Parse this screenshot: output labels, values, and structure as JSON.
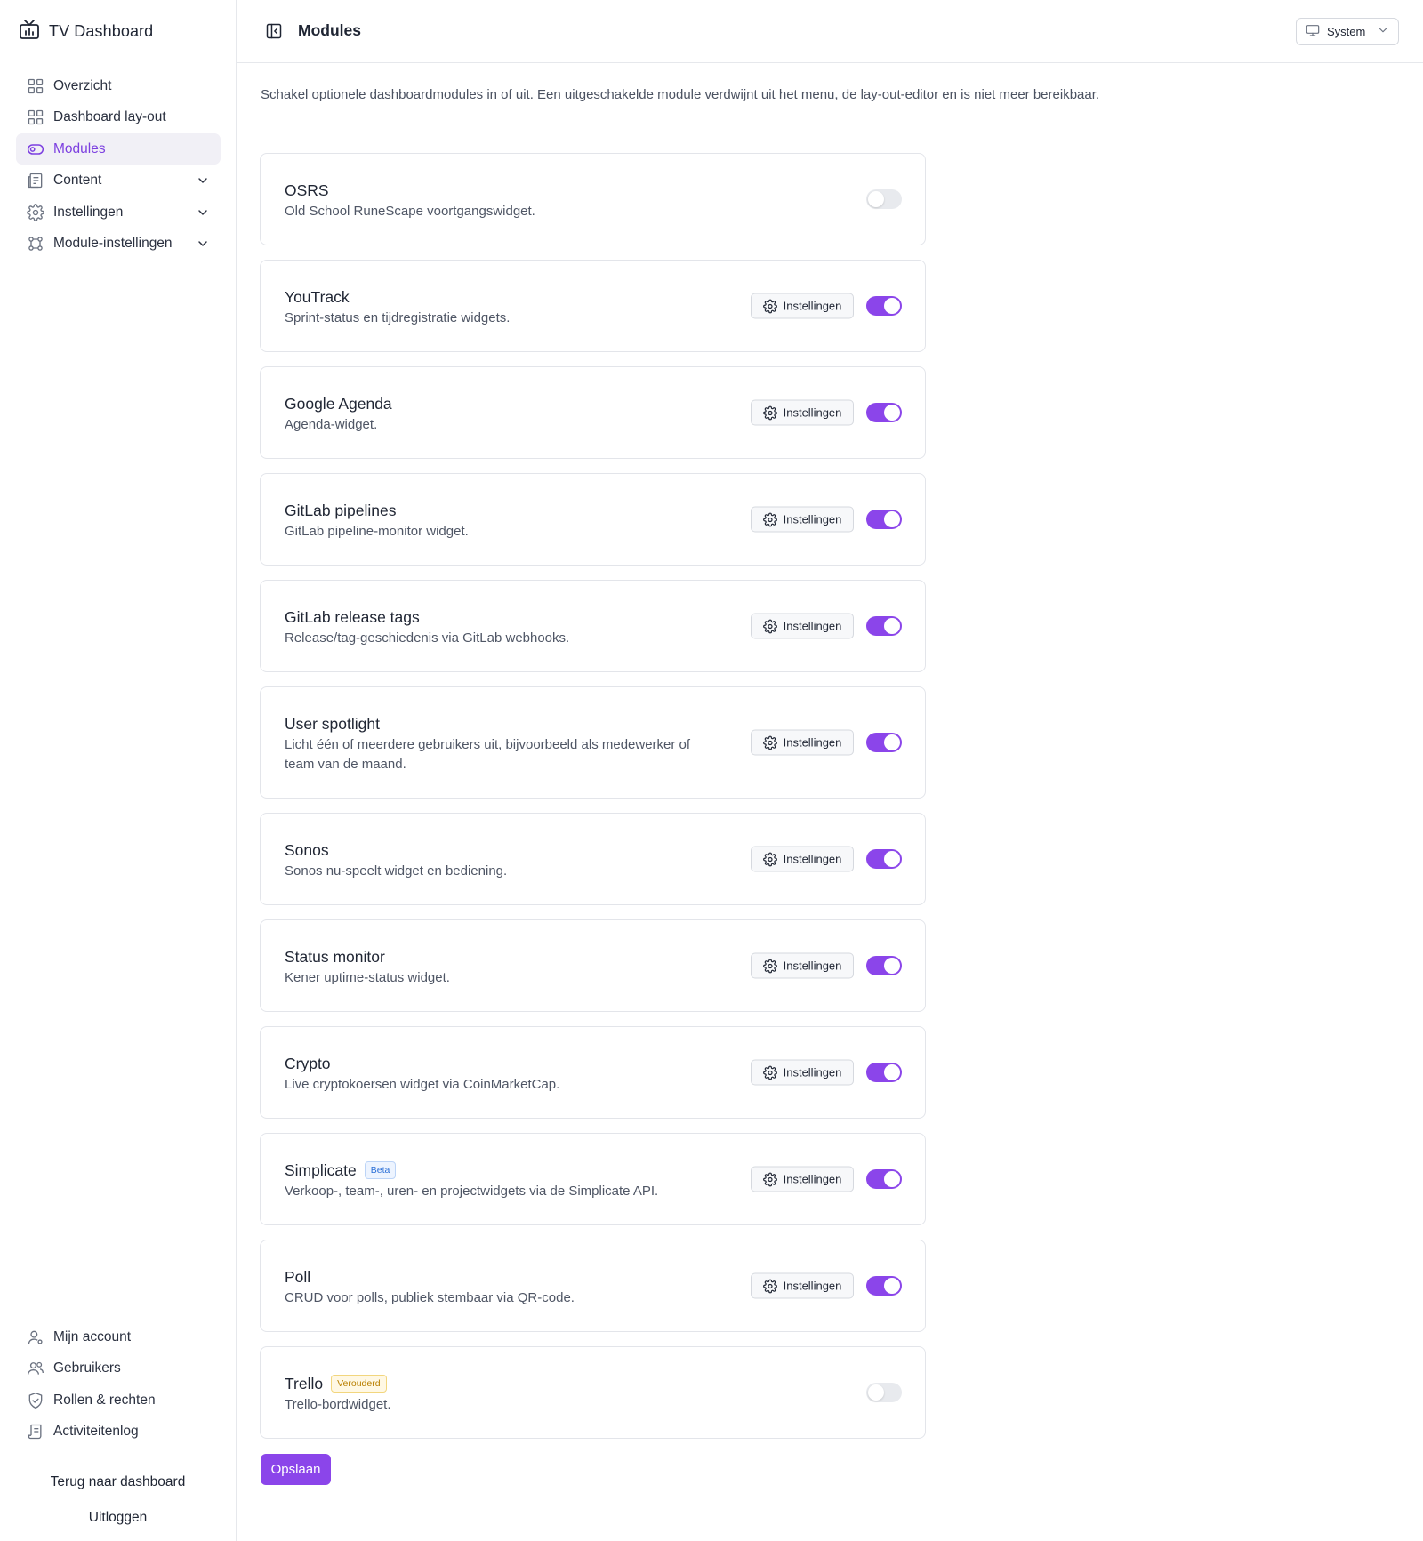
{
  "app": {
    "title": "TV Dashboard"
  },
  "sidebar": {
    "nav": [
      {
        "label": "Overzicht",
        "icon": "grid-icon",
        "active": false,
        "expandable": false
      },
      {
        "label": "Dashboard lay-out",
        "icon": "layout-icon",
        "active": false,
        "expandable": false
      },
      {
        "label": "Modules",
        "icon": "toggle-icon",
        "active": true,
        "expandable": false
      },
      {
        "label": "Content",
        "icon": "content-icon",
        "active": false,
        "expandable": true
      },
      {
        "label": "Instellingen",
        "icon": "gear-icon",
        "active": false,
        "expandable": true
      },
      {
        "label": "Module-instellingen",
        "icon": "puzzle-icon",
        "active": false,
        "expandable": true
      }
    ],
    "bottom_nav": [
      {
        "label": "Mijn account",
        "icon": "user-icon"
      },
      {
        "label": "Gebruikers",
        "icon": "users-icon"
      },
      {
        "label": "Rollen & rechten",
        "icon": "shield-icon"
      },
      {
        "label": "Activiteitenlog",
        "icon": "log-icon"
      }
    ],
    "footer": {
      "back_label": "Terug naar dashboard",
      "logout_label": "Uitloggen"
    }
  },
  "header": {
    "title": "Modules",
    "theme_select": {
      "value": "System"
    }
  },
  "main": {
    "intro": "Schakel optionele dashboardmodules in of uit. Een uitgeschakelde module verdwijnt uit het menu, de lay-out-editor en is niet meer bereikbaar.",
    "settings_label": "Instellingen",
    "save_label": "Opslaan",
    "modules": [
      {
        "title": "OSRS",
        "description": "Old School RuneScape voortgangswidget.",
        "enabled": false,
        "has_settings": false
      },
      {
        "title": "YouTrack",
        "description": "Sprint-status en tijdregistratie widgets.",
        "enabled": true,
        "has_settings": true
      },
      {
        "title": "Google Agenda",
        "description": "Agenda-widget.",
        "enabled": true,
        "has_settings": true
      },
      {
        "title": "GitLab pipelines",
        "description": "GitLab pipeline-monitor widget.",
        "enabled": true,
        "has_settings": true
      },
      {
        "title": "GitLab release tags",
        "description": "Release/tag-geschiedenis via GitLab webhooks.",
        "enabled": true,
        "has_settings": true
      },
      {
        "title": "User spotlight",
        "description": "Licht één of meerdere gebruikers uit, bijvoorbeeld als medewerker of team van de maand.",
        "enabled": true,
        "has_settings": true,
        "tall": true
      },
      {
        "title": "Sonos",
        "description": "Sonos nu-speelt widget en bediening.",
        "enabled": true,
        "has_settings": true
      },
      {
        "title": "Status monitor",
        "description": "Kener uptime-status widget.",
        "enabled": true,
        "has_settings": true
      },
      {
        "title": "Crypto",
        "description": "Live cryptokoersen widget via CoinMarketCap.",
        "enabled": true,
        "has_settings": true
      },
      {
        "title": "Simplicate",
        "badge": "Beta",
        "badge_type": "beta",
        "description": "Verkoop-, team-, uren- en projectwidgets via de Simplicate API.",
        "enabled": true,
        "has_settings": true
      },
      {
        "title": "Poll",
        "description": "CRUD voor polls, publiek stembaar via QR-code.",
        "enabled": true,
        "has_settings": true
      },
      {
        "title": "Trello",
        "badge": "Verouderd",
        "badge_type": "old",
        "description": "Trello-bordwidget.",
        "enabled": false,
        "has_settings": false
      }
    ]
  },
  "colors": {
    "accent": "#8b45ea",
    "active_nav_text": "#7c3fe0",
    "active_nav_bg": "#f1f0f6",
    "toggle_off": "#e8eaee"
  }
}
